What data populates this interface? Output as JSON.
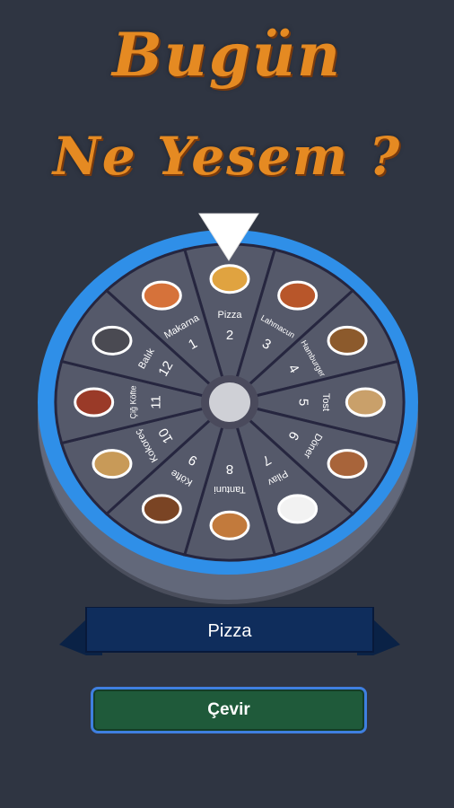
{
  "title": {
    "line1": "Bugün",
    "line2": "Ne Yesem ?"
  },
  "wheel": {
    "segments": [
      {
        "number": "2",
        "label": "Pizza",
        "icon": "pizza-icon"
      },
      {
        "number": "3",
        "label": "Lahmacun",
        "icon": "lahmacun-icon"
      },
      {
        "number": "4",
        "label": "Hamburger",
        "icon": "hamburger-icon"
      },
      {
        "number": "5",
        "label": "Tost",
        "icon": "toast-icon"
      },
      {
        "number": "6",
        "label": "Döner",
        "icon": "doner-icon"
      },
      {
        "number": "7",
        "label": "Pilav",
        "icon": "rice-icon"
      },
      {
        "number": "8",
        "label": "Tantuni",
        "icon": "tantuni-icon"
      },
      {
        "number": "9",
        "label": "Köfte",
        "icon": "kofte-icon"
      },
      {
        "number": "10",
        "label": "Kokoreç",
        "icon": "kokorec-icon"
      },
      {
        "number": "11",
        "label": "Çiğ Köfte",
        "icon": "cig-kofte-icon"
      },
      {
        "number": "12",
        "label": "Balık",
        "icon": "fish-icon"
      },
      {
        "number": "1",
        "label": "Makarna",
        "icon": "pasta-icon"
      }
    ]
  },
  "result": {
    "text": "Pizza"
  },
  "spin_button": {
    "label": "Çevir"
  },
  "colors": {
    "background": "#2f3542",
    "title": "#e58a22",
    "wheel_ring": "#2f8fe8",
    "segment": "#55596a",
    "divider": "#26263f",
    "ribbon": "#0d2a55",
    "button": "#1f5a3a",
    "button_border": "#3f7fe0"
  }
}
